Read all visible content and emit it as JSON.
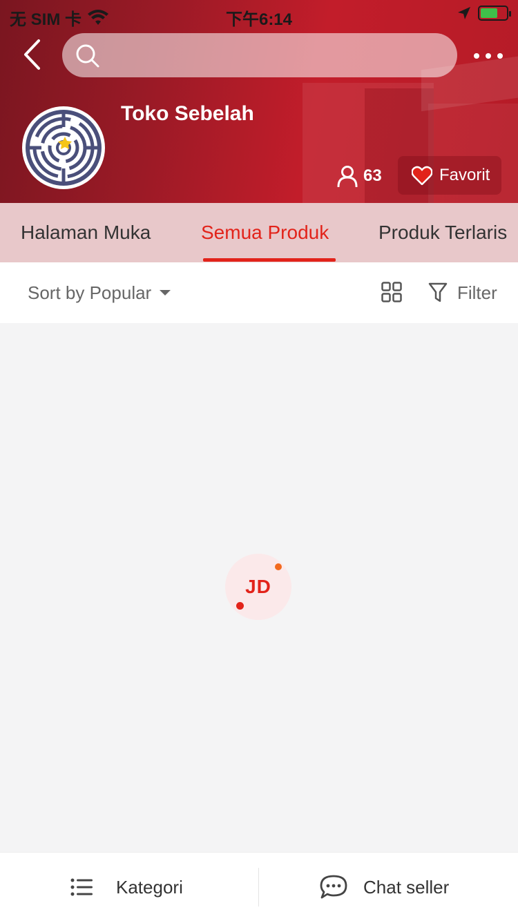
{
  "status_bar": {
    "carrier": "无 SIM 卡",
    "time": "下午6:14"
  },
  "search": {
    "placeholder": ""
  },
  "store": {
    "name": "Toko Sebelah",
    "followers": "63",
    "favorite_label": "Favorit"
  },
  "tabs": [
    {
      "label": "Halaman Muka",
      "active": false
    },
    {
      "label": "Semua Produk",
      "active": true
    },
    {
      "label": "Produk Terlaris",
      "active": false
    }
  ],
  "toolbar": {
    "sort_label": "Sort by Popular",
    "filter_label": "Filter"
  },
  "loader": {
    "logo_text": "JD"
  },
  "bottom_bar": {
    "category_label": "Kategori",
    "chat_label": "Chat seller"
  },
  "colors": {
    "accent": "#e2231a",
    "header_red": "#c21d2a"
  }
}
